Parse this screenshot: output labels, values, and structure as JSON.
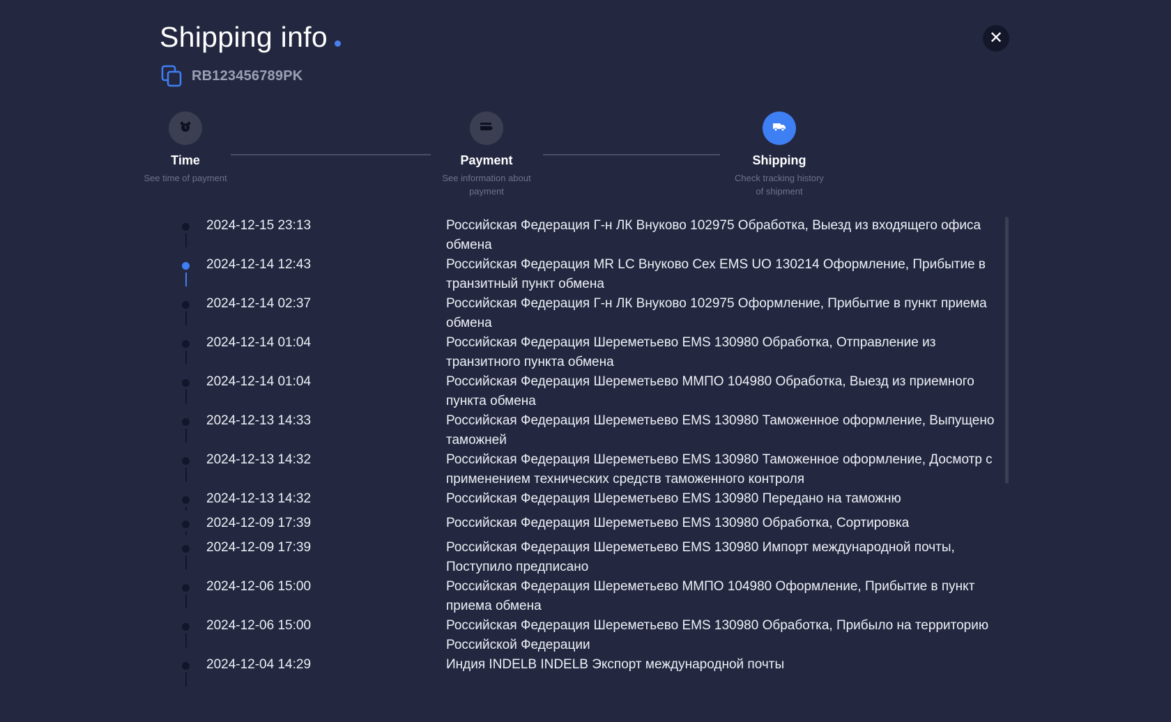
{
  "modal": {
    "title": "Shipping info",
    "close_label": "✕",
    "tracking_number": "RB123456789PK"
  },
  "colors": {
    "background": "#232840",
    "accent": "#3f7ff4",
    "inactive_step": "#3b3f51",
    "muted_text": "#6d7388"
  },
  "steps": [
    {
      "label": "Time",
      "desc": "See time of payment",
      "icon": "alarm-clock-icon",
      "active": false
    },
    {
      "label": "Payment",
      "desc": "See information about payment",
      "icon": "credit-card-icon",
      "active": false
    },
    {
      "label": "Shipping",
      "desc": "Check tracking history of shipment",
      "icon": "truck-icon",
      "active": true
    }
  ],
  "events": [
    {
      "date": "2024-12-15 23:13",
      "text": "Российская Федерация Г-н ЛК Внуково 102975 Обработка, Выезд из входящего офиса обмена",
      "active": false
    },
    {
      "date": "2024-12-14 12:43",
      "text": "Российская Федерация MR LC Внуково Сех EMS UO 130214 Оформление, Прибытие в транзитный пункт обмена",
      "active": true
    },
    {
      "date": "2024-12-14 02:37",
      "text": "Российская Федерация Г-н ЛК Внуково 102975 Оформление, Прибытие в пункт приема обмена",
      "active": false
    },
    {
      "date": "2024-12-14 01:04",
      "text": "Российская Федерация Шереметьево EMS 130980 Обработка, Отправление из транзитного пункта обмена",
      "active": false
    },
    {
      "date": "2024-12-14 01:04",
      "text": "Российская Федерация Шереметьево ММПО 104980 Обработка, Выезд из приемного пункта обмена",
      "active": false
    },
    {
      "date": "2024-12-13 14:33",
      "text": "Российская Федерация Шереметьево EMS 130980 Таможенное оформление, Выпущено таможней",
      "active": false
    },
    {
      "date": "2024-12-13 14:32",
      "text": "Российская Федерация Шереметьево EMS 130980 Таможенное оформление, Досмотр с применением технических средств таможенного контроля",
      "active": false
    },
    {
      "date": "2024-12-13 14:32",
      "text": "Российская Федерация Шереметьево EMS 130980 Передано на таможню",
      "active": false
    },
    {
      "date": "2024-12-09 17:39",
      "text": "Российская Федерация Шереметьево EMS 130980 Обработка, Сортировка",
      "active": false
    },
    {
      "date": "2024-12-09 17:39",
      "text": "Российская Федерация Шереметьево EMS 130980 Импорт международной почты, Поступило предписано",
      "active": false
    },
    {
      "date": "2024-12-06 15:00",
      "text": "Российская Федерация Шереметьево ММПО 104980 Оформление, Прибытие в пункт приема обмена",
      "active": false
    },
    {
      "date": "2024-12-06 15:00",
      "text": "Российская Федерация Шереметьево EMS 130980 Обработка, Прибыло на территорию Российской Федерации",
      "active": false
    },
    {
      "date": "2024-12-04 14:29",
      "text": "Индия INDELB INDELB Экспорт международной почты",
      "active": false
    }
  ]
}
